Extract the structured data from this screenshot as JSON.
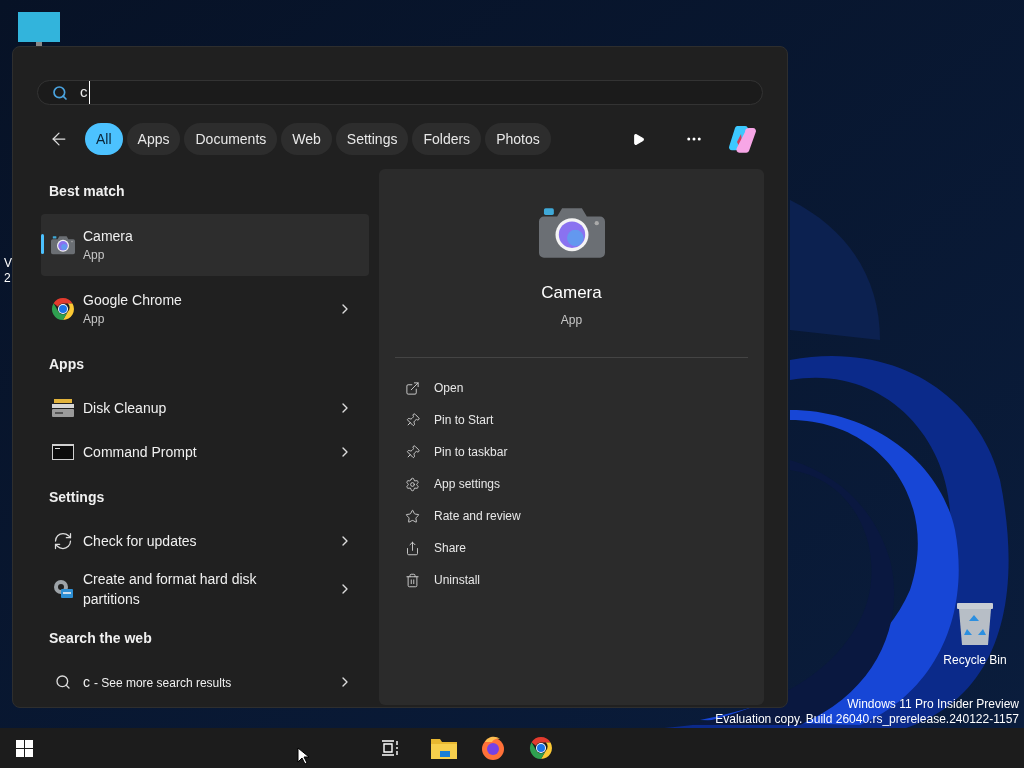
{
  "desktop": {
    "cut_label": [
      "V",
      "2"
    ],
    "icons": [
      {
        "kind": "recycle",
        "label": "Recycle Bin"
      }
    ],
    "watermark": [
      "Windows 11 Pro Insider Preview",
      "Evaluation copy. Build 26040.rs_prerelease.240122-1157"
    ]
  },
  "search": {
    "value": "c"
  },
  "filters": [
    {
      "label": "All",
      "selected": true
    },
    {
      "label": "Apps",
      "selected": false
    },
    {
      "label": "Documents",
      "selected": false
    },
    {
      "label": "Web",
      "selected": false
    },
    {
      "label": "Settings",
      "selected": false
    },
    {
      "label": "Folders",
      "selected": false
    },
    {
      "label": "Photos",
      "selected": false
    }
  ],
  "sections": [
    {
      "heading": "Best match",
      "items": [
        {
          "kind": "camera",
          "title": "Camera",
          "subtitle": "App",
          "selected": true,
          "arrow": false
        },
        {
          "kind": "chrome",
          "title": "Google Chrome",
          "subtitle": "App",
          "selected": false,
          "arrow": true
        }
      ]
    },
    {
      "heading": "Apps",
      "items": [
        {
          "kind": "disk",
          "title": "Disk Cleanup",
          "selected": false,
          "arrow": true
        },
        {
          "kind": "cmd",
          "title": "Command Prompt",
          "selected": false,
          "arrow": true
        }
      ]
    },
    {
      "heading": "Settings",
      "items": [
        {
          "kind": "sync",
          "title": "Check for updates",
          "selected": false,
          "arrow": true
        },
        {
          "kind": "partition",
          "title": "Create and format hard disk partitions",
          "selected": false,
          "arrow": true
        }
      ]
    },
    {
      "heading": "Search the web",
      "items": [
        {
          "kind": "web",
          "title": "c",
          "hint": "- See more search results",
          "selected": false,
          "arrow": true
        }
      ]
    }
  ],
  "details": {
    "title": "Camera",
    "subtitle": "App",
    "actions": [
      {
        "kind": "open",
        "label": "Open"
      },
      {
        "kind": "pin",
        "label": "Pin to Start"
      },
      {
        "kind": "pin",
        "label": "Pin to taskbar"
      },
      {
        "kind": "settings",
        "label": "App settings"
      },
      {
        "kind": "rate",
        "label": "Rate and review"
      },
      {
        "kind": "share",
        "label": "Share"
      },
      {
        "kind": "uninstall",
        "label": "Uninstall"
      }
    ]
  }
}
